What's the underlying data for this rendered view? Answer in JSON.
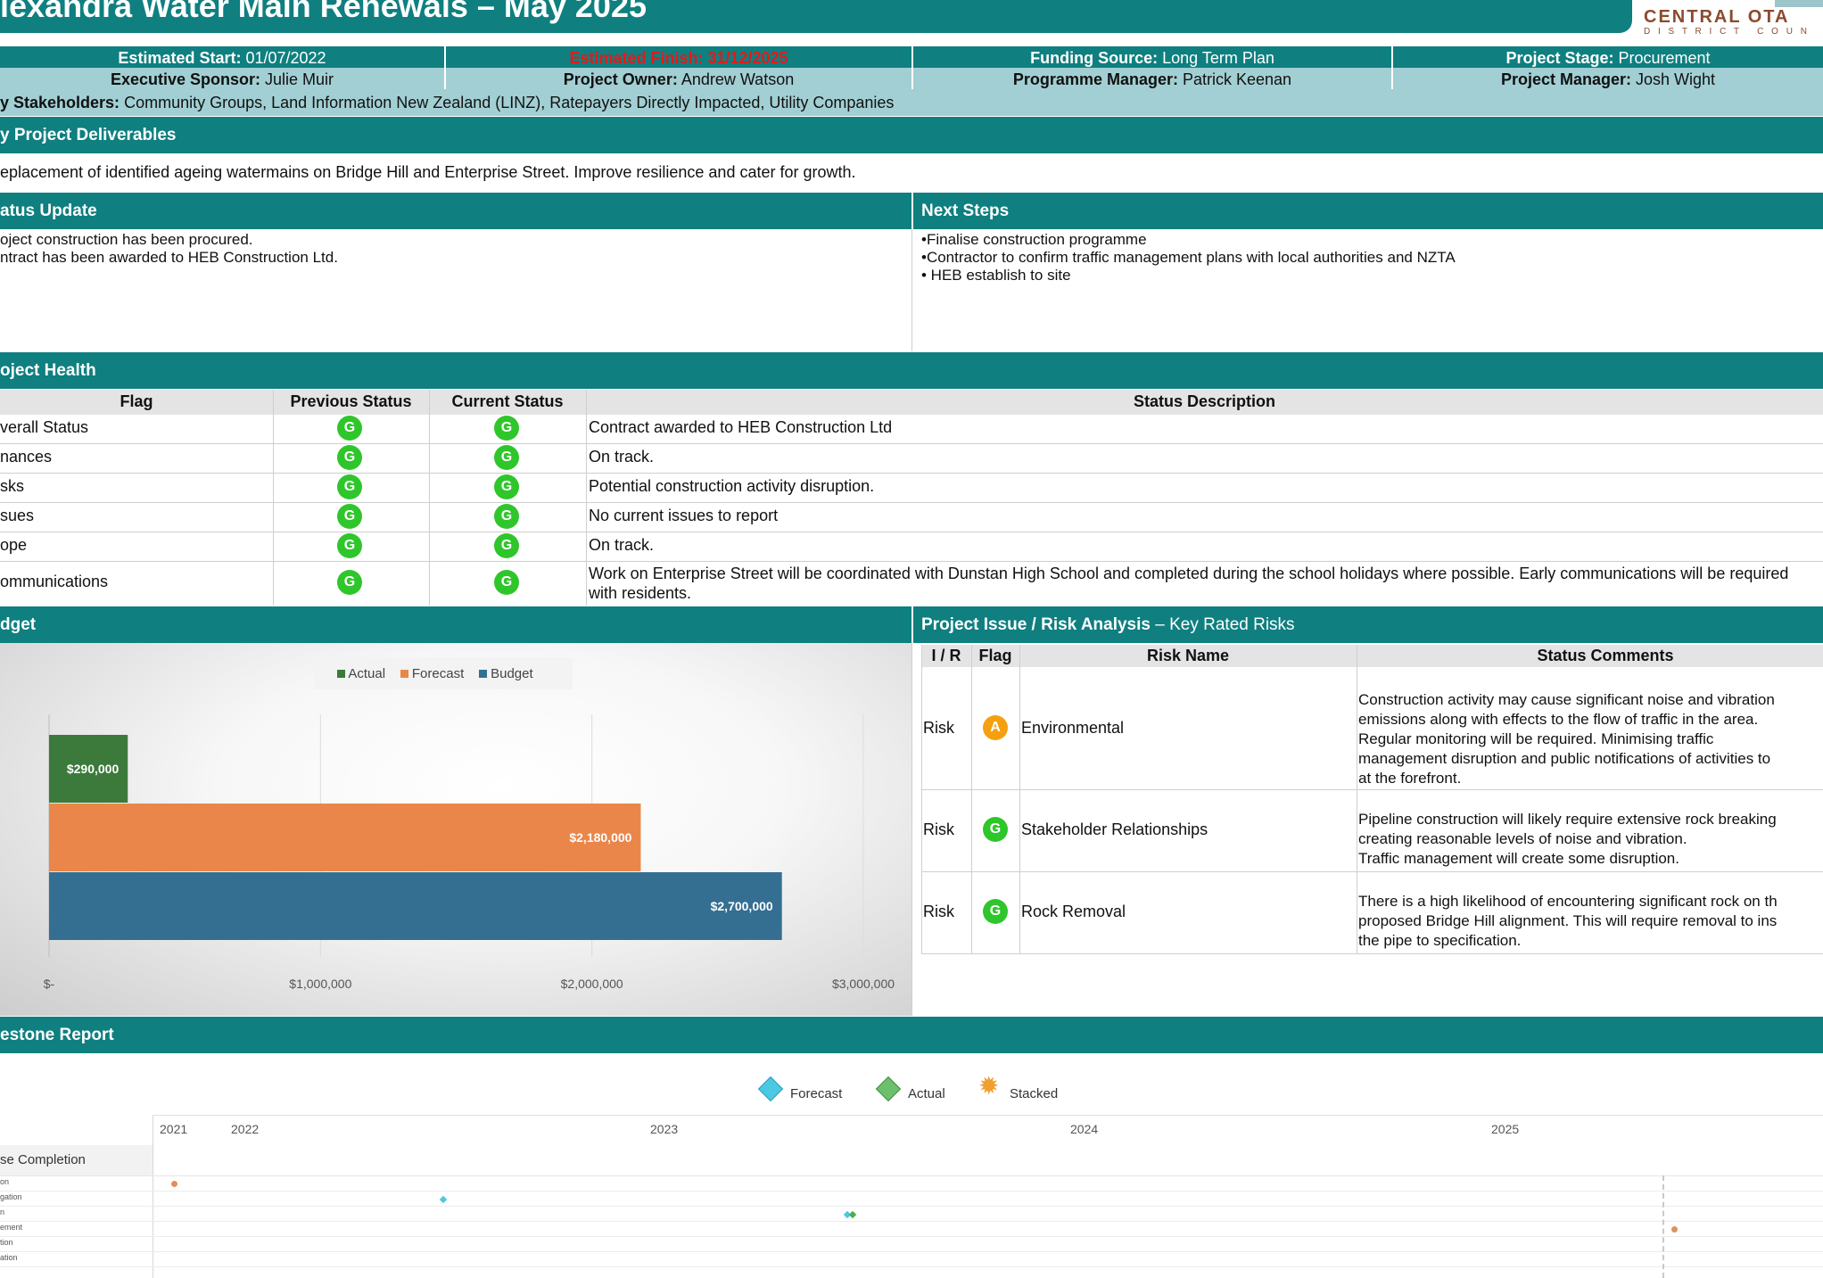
{
  "title": "lexandra Water Main Renewals – May 2025",
  "logo": {
    "line1": "CENTRAL OTA",
    "line2": "D I S T R I C T   C O U N"
  },
  "summary": {
    "est_start_label": "Estimated Start:",
    "est_start": "01/07/2022",
    "est_finish": "Estimated Finish: 31/12/2025",
    "funding_label": "Funding Source:",
    "funding": "Long Term Plan",
    "stage_label": "Project Stage:",
    "stage": "Procurement",
    "sponsor_label": "Executive Sponsor:",
    "sponsor": "Julie Muir",
    "owner_label": "Project Owner:",
    "owner": "Andrew Watson",
    "prog_mgr_label": "Programme Manager:",
    "prog_mgr": "Patrick Keenan",
    "proj_mgr_label": "Project Manager:",
    "proj_mgr": "Josh Wight",
    "stakeholders_label": "y Stakeholders:",
    "stakeholders": "Community Groups, Land Information New Zealand (LINZ), Ratepayers Directly Impacted, Utility Companies"
  },
  "deliverables": {
    "title": "y Project Deliverables",
    "text": "eplacement of identified ageing watermains on Bridge Hill and Enterprise Street. Improve resilience and cater for growth."
  },
  "status_update": {
    "title": "atus Update",
    "lines": [
      "oject construction has been procured.",
      "ntract has been awarded to HEB Construction Ltd."
    ]
  },
  "next_steps": {
    "title": "Next Steps",
    "lines": [
      "•Finalise construction programme",
      "•Contractor to confirm traffic management plans with local authorities and NZTA",
      "• HEB establish to site"
    ]
  },
  "health": {
    "title": "oject Health",
    "headers": [
      "Flag",
      "Previous Status",
      "Current Status",
      "Status Description"
    ],
    "rows": [
      {
        "flag": "verall Status",
        "prev": "G",
        "curr": "G",
        "desc": "Contract awarded to HEB Construction Ltd"
      },
      {
        "flag": "nances",
        "prev": "G",
        "curr": "G",
        "desc": "On track."
      },
      {
        "flag": "sks",
        "prev": "G",
        "curr": "G",
        "desc": "Potential construction activity disruption."
      },
      {
        "flag": "sues",
        "prev": "G",
        "curr": "G",
        "desc": "No current issues to report"
      },
      {
        "flag": "ope",
        "prev": "G",
        "curr": "G",
        "desc": "On track."
      },
      {
        "flag": "ommunications",
        "prev": "G",
        "curr": "G",
        "desc": "Work on Enterprise Street will be coordinated with Dunstan High School and completed during the school holidays where possible. Early communications will be required with residents."
      }
    ]
  },
  "budget": {
    "title": "dget",
    "legend": [
      "Actual",
      "Forecast",
      "Budget"
    ],
    "colors": {
      "actual": "#3b7a3b",
      "forecast": "#ea864a",
      "budget": "#346f92"
    },
    "bar_labels": [
      "$290,000",
      "$2,180,000",
      "$2,700,000"
    ],
    "axis_labels": [
      "$-",
      "$1,000,000",
      "$2,000,000",
      "$3,000,000"
    ]
  },
  "chart_data": {
    "type": "bar",
    "orientation": "horizontal",
    "categories": [
      "Actual",
      "Forecast",
      "Budget"
    ],
    "values": [
      290000,
      2180000,
      2700000
    ],
    "xlim": [
      0,
      3000000
    ],
    "xticks": [
      0,
      1000000,
      2000000,
      3000000
    ],
    "grid": true,
    "legend_position": "top"
  },
  "risk": {
    "title_bold": "Project Issue / Risk Analysis",
    "title_rest": " – Key Rated Risks",
    "headers": [
      "I / R",
      "Flag",
      "Risk Name",
      "Status Comments"
    ],
    "rows": [
      {
        "ir": "Risk",
        "flag": "A",
        "name": "Environmental",
        "comments": [
          "Construction activity may cause significant noise and vibration",
          "emissions along with effects to the flow of traffic in the area.",
          "Regular monitoring will be required. Minimising traffic",
          "management disruption and public notifications of activities to",
          "at the forefront."
        ]
      },
      {
        "ir": "Risk",
        "flag": "G",
        "name": "Stakeholder Relationships",
        "comments": [
          "Pipeline construction will likely require extensive rock breaking",
          "creating reasonable levels of noise and vibration.",
          "Traffic management will create some disruption."
        ]
      },
      {
        "ir": "Risk",
        "flag": "G",
        "name": "Rock Removal",
        "comments": [
          "There is a high likelihood of encountering significant rock on th",
          "proposed Bridge Hill alignment. This will require removal to ins",
          "the pipe to specification."
        ]
      }
    ]
  },
  "milestone": {
    "title": "estone Report",
    "legend": [
      "Forecast",
      "Actual",
      "Stacked"
    ],
    "years": [
      "2021",
      "2022",
      "2023",
      "2024",
      "2025"
    ],
    "column_header": "se Completion",
    "rows": [
      "on",
      "gation",
      "n",
      "ement",
      "tion",
      "ation"
    ]
  }
}
